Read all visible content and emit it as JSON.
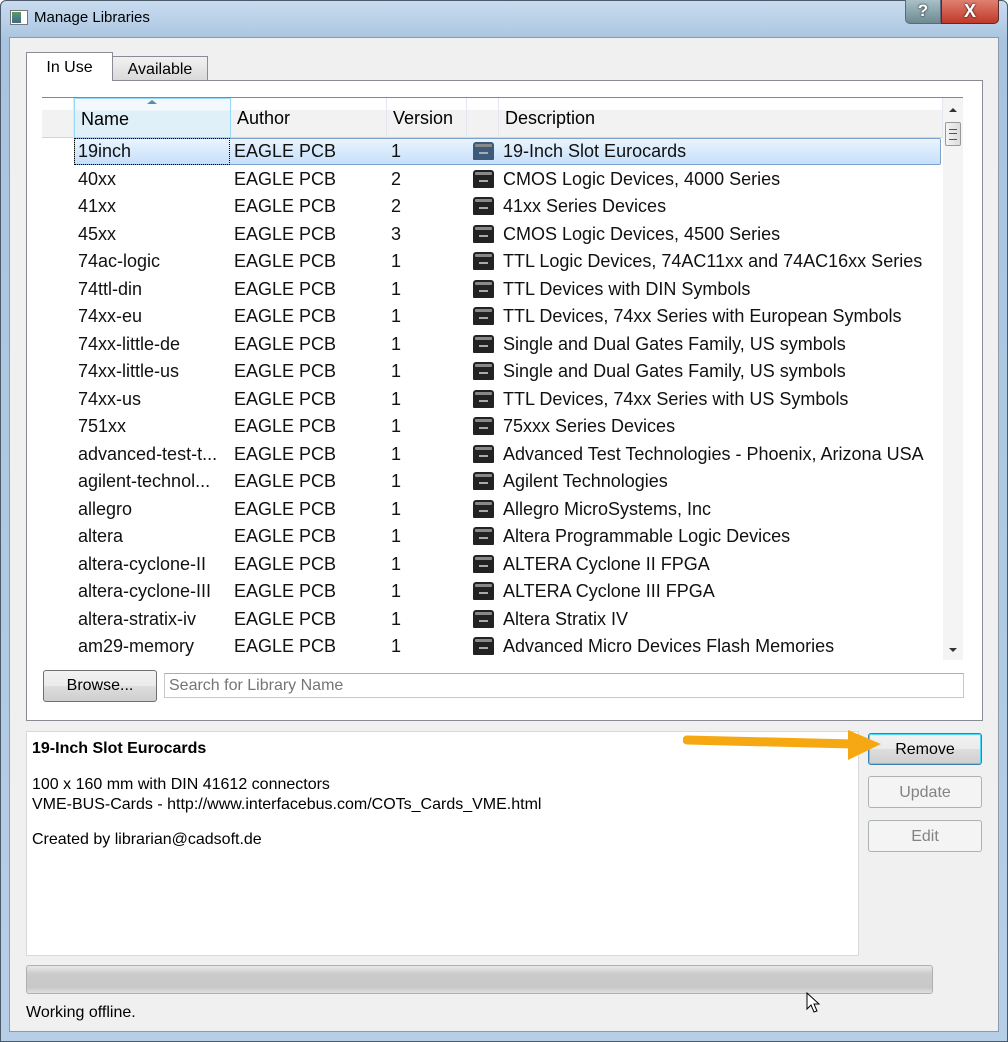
{
  "window": {
    "title": "Manage Libraries",
    "help_label": "?",
    "close_label": "X"
  },
  "tabs": [
    {
      "label": "In Use"
    },
    {
      "label": "Available"
    }
  ],
  "columns": [
    "Name",
    "Author",
    "Version",
    "",
    "Description"
  ],
  "rows": [
    {
      "name": "19inch",
      "author": "EAGLE PCB",
      "version": "1",
      "description": "19-Inch Slot Eurocards"
    },
    {
      "name": "40xx",
      "author": "EAGLE PCB",
      "version": "2",
      "description": "CMOS Logic Devices, 4000 Series"
    },
    {
      "name": "41xx",
      "author": "EAGLE PCB",
      "version": "2",
      "description": "41xx Series Devices"
    },
    {
      "name": "45xx",
      "author": "EAGLE PCB",
      "version": "3",
      "description": "CMOS Logic Devices, 4500 Series"
    },
    {
      "name": "74ac-logic",
      "author": "EAGLE PCB",
      "version": "1",
      "description": "TTL Logic Devices, 74AC11xx and 74AC16xx Series"
    },
    {
      "name": "74ttl-din",
      "author": "EAGLE PCB",
      "version": "1",
      "description": "TTL Devices with DIN Symbols"
    },
    {
      "name": "74xx-eu",
      "author": "EAGLE PCB",
      "version": "1",
      "description": "TTL Devices, 74xx Series with European Symbols"
    },
    {
      "name": "74xx-little-de",
      "author": "EAGLE PCB",
      "version": "1",
      "description": "Single and Dual Gates Family, US symbols"
    },
    {
      "name": "74xx-little-us",
      "author": "EAGLE PCB",
      "version": "1",
      "description": "Single and Dual Gates Family, US symbols"
    },
    {
      "name": "74xx-us",
      "author": "EAGLE PCB",
      "version": "1",
      "description": "TTL Devices, 74xx Series with US Symbols"
    },
    {
      "name": "751xx",
      "author": "EAGLE PCB",
      "version": "1",
      "description": "75xxx Series Devices"
    },
    {
      "name": "advanced-test-t...",
      "author": "EAGLE PCB",
      "version": "1",
      "description": "Advanced Test Technologies - Phoenix, Arizona USA"
    },
    {
      "name": "agilent-technol...",
      "author": "EAGLE PCB",
      "version": "1",
      "description": "Agilent Technologies"
    },
    {
      "name": "allegro",
      "author": "EAGLE PCB",
      "version": "1",
      "description": "Allegro MicroSystems, Inc"
    },
    {
      "name": "altera",
      "author": "EAGLE PCB",
      "version": "1",
      "description": "Altera Programmable Logic Devices"
    },
    {
      "name": "altera-cyclone-II",
      "author": "EAGLE PCB",
      "version": "1",
      "description": "ALTERA Cyclone II FPGA"
    },
    {
      "name": "altera-cyclone-III",
      "author": "EAGLE PCB",
      "version": "1",
      "description": "ALTERA Cyclone III FPGA"
    },
    {
      "name": "altera-stratix-iv",
      "author": "EAGLE PCB",
      "version": "1",
      "description": "Altera Stratix IV"
    },
    {
      "name": "am29-memory",
      "author": "EAGLE PCB",
      "version": "1",
      "description": "Advanced Micro Devices Flash Memories"
    }
  ],
  "browse_label": "Browse...",
  "search": {
    "placeholder": "Search for Library Name",
    "value": ""
  },
  "details": {
    "title": "19-Inch Slot Eurocards",
    "line1": "100 x 160 mm with DIN 41612 connectors",
    "line2": "VME-BUS-Cards - http://www.interfacebus.com/COTs_Cards_VME.html",
    "line3": "Created by librarian@cadsoft.de"
  },
  "buttons": {
    "remove": "Remove",
    "update": "Update",
    "edit": "Edit"
  },
  "progress": 0,
  "status": "Working offline.",
  "colors": {
    "arrow": "#f5a812",
    "selection": "#c6e0fa"
  }
}
